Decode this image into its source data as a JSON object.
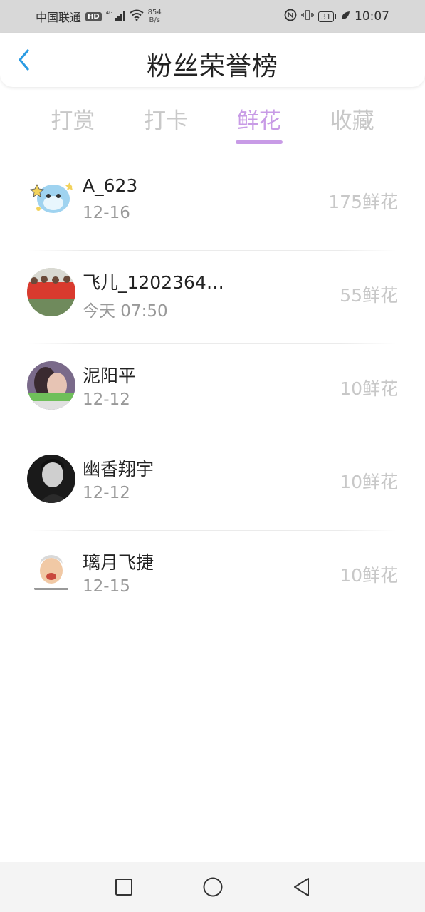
{
  "status_bar": {
    "carrier": "中国联通",
    "hd": "HD",
    "network_gen": "4G",
    "speed_value": "854",
    "speed_unit": "B/s",
    "battery": "31",
    "time": "10:07"
  },
  "header": {
    "title": "粉丝荣誉榜"
  },
  "tabs": [
    {
      "label": "打赏",
      "active": false
    },
    {
      "label": "打卡",
      "active": false
    },
    {
      "label": "鲜花",
      "active": true
    },
    {
      "label": "收藏",
      "active": false
    }
  ],
  "list": [
    {
      "name": "A_623",
      "date": "12-16",
      "count": "175鲜花",
      "avatar": "cartoon-avatar"
    },
    {
      "name": "飞儿_1202364…",
      "date": "今天 07:50",
      "count": "55鲜花",
      "avatar": "group-photo-avatar"
    },
    {
      "name": "泥阳平",
      "date": "12-12",
      "count": "10鲜花",
      "avatar": "portrait-avatar"
    },
    {
      "name": "幽香翔宇",
      "date": "12-12",
      "count": "10鲜花",
      "avatar": "dark-portrait-avatar"
    },
    {
      "name": "璃月飞捷",
      "date": "12-15",
      "count": "10鲜花",
      "avatar": "sticker-avatar"
    }
  ],
  "colors": {
    "accent": "#c89be6",
    "back_arrow": "#2a9be3",
    "inactive_tab": "#c8c8c8",
    "status_bar_bg": "#d8d8d8"
  }
}
